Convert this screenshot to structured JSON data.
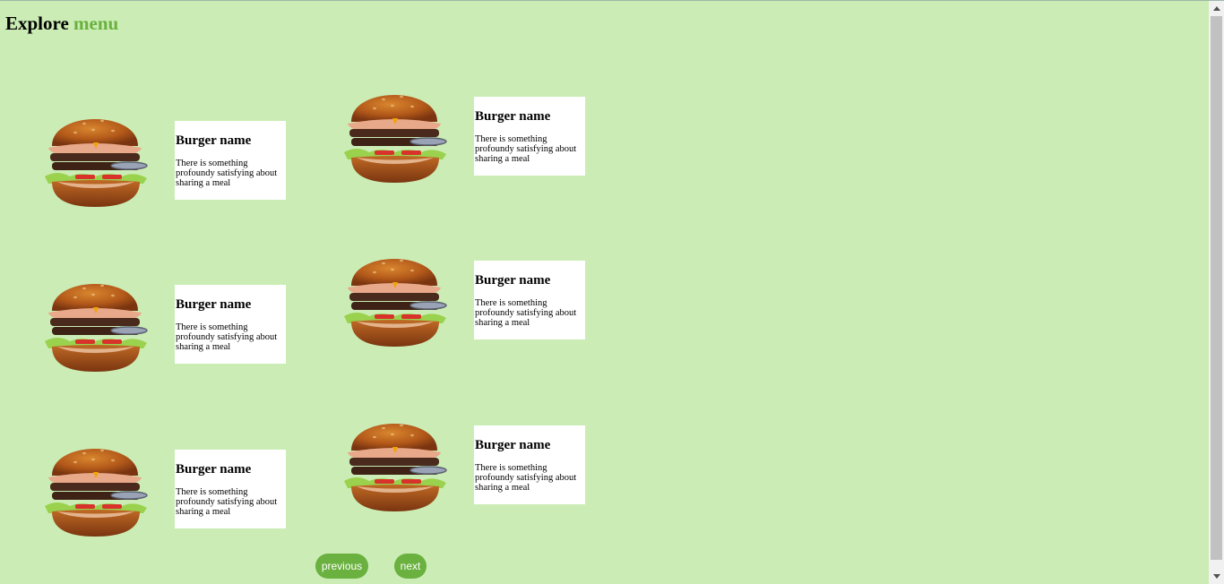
{
  "title": {
    "prefix": "Explore",
    "accent": "menu",
    "accent_color": "#6ab13f"
  },
  "menu_items": [
    {
      "name": "Burger name",
      "description": "There is something profoundy satisfying about sharing a meal"
    },
    {
      "name": "Burger name",
      "description": "There is something profoundy satisfying about sharing a meal"
    },
    {
      "name": "Burger name",
      "description": "There is something profoundy satisfying about sharing a meal"
    },
    {
      "name": "Burger name",
      "description": "There is something profoundy satisfying about sharing a meal"
    },
    {
      "name": "Burger name",
      "description": "There is something profoundy satisfying about sharing a meal"
    },
    {
      "name": "Burger name",
      "description": "There is something profoundy satisfying about sharing a meal"
    }
  ],
  "pagination": {
    "previous_label": "previous",
    "next_label": "next"
  },
  "colors": {
    "background": "#cbedb5",
    "button": "#6ab13f"
  }
}
